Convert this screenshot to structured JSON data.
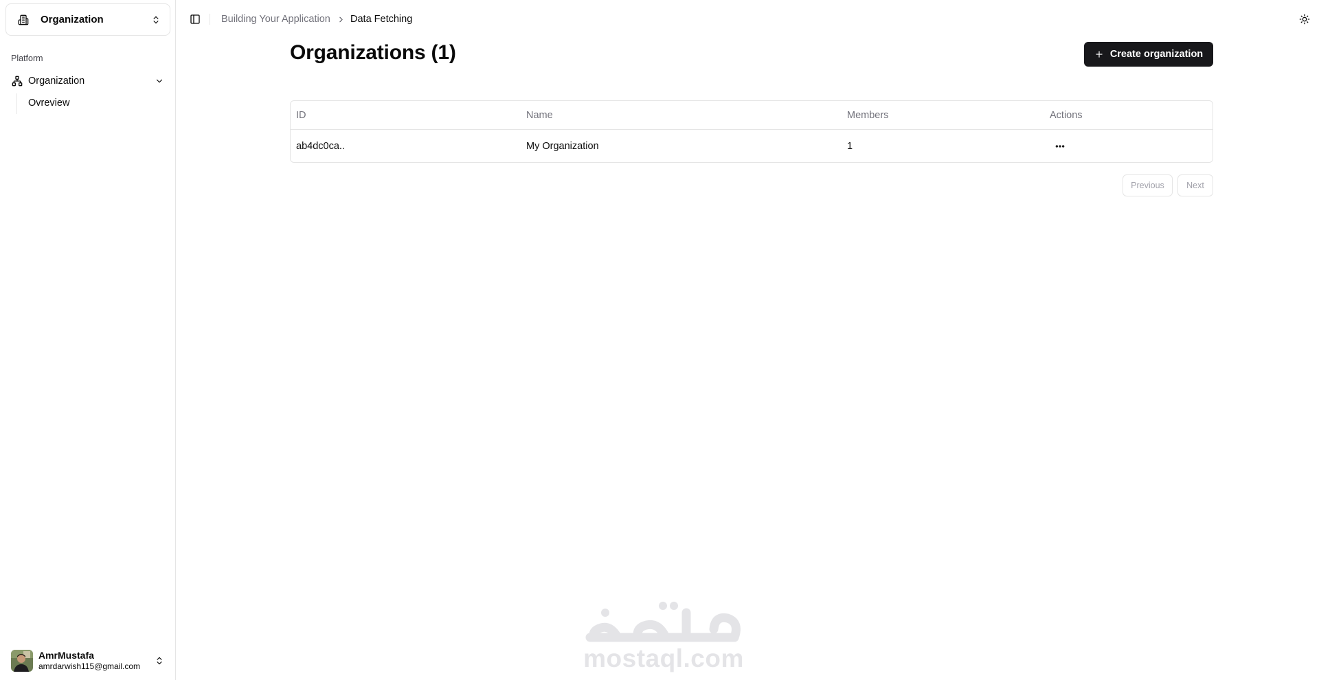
{
  "sidebar": {
    "org_switcher": {
      "name": "Organization",
      "icon": "building-icon"
    },
    "group_label": "Platform",
    "nav": {
      "label": "Organization",
      "icon": "network-icon",
      "sub_items": [
        {
          "label": "Ovreview"
        }
      ]
    },
    "user": {
      "name": "AmrMustafa",
      "email": "amrdarwish115@gmail.com"
    }
  },
  "header": {
    "breadcrumb": [
      "Building Your Application",
      "Data Fetching"
    ]
  },
  "main": {
    "title": "Organizations (1)",
    "create_label": "Create organization",
    "table": {
      "columns": [
        "ID",
        "Name",
        "Members",
        "Actions"
      ],
      "rows": [
        {
          "id": "ab4dc0ca..",
          "name": "My Organization",
          "members": "1"
        }
      ]
    },
    "pagination": {
      "previous": "Previous",
      "next": "Next"
    }
  },
  "watermark": {
    "text": "mostaql.com"
  },
  "colors": {
    "primary": "#18181b",
    "border": "#e5e5e5",
    "muted_text": "#71717a",
    "watermark": "#e4e4e7"
  }
}
